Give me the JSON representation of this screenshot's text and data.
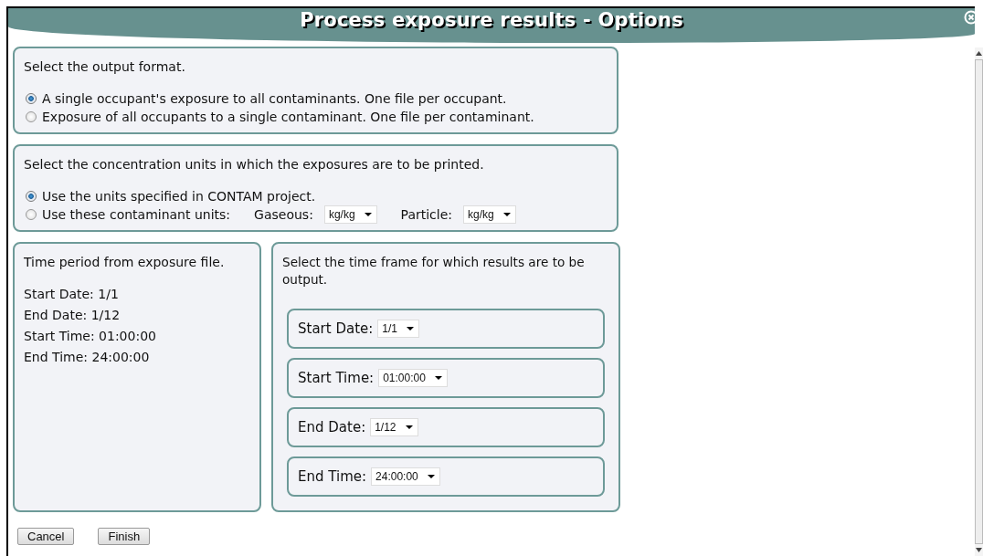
{
  "window": {
    "title": "Process exposure results - Options"
  },
  "output_format": {
    "prompt": "Select the output format.",
    "options": [
      {
        "label": "A single occupant's exposure to all contaminants. One file per occupant.",
        "selected": true
      },
      {
        "label": "Exposure of all occupants to a single contaminant. One file per contaminant.",
        "selected": false
      }
    ]
  },
  "units": {
    "prompt": "Select the concentration units in which the exposures are to be printed.",
    "options": [
      {
        "label": "Use the units specified in CONTAM project.",
        "selected": true
      },
      {
        "label": "Use these contaminant units:",
        "selected": false,
        "selects": [
          {
            "label": "Gaseous:",
            "value": "kg/kg"
          },
          {
            "label": "Particle:",
            "value": "kg/kg"
          }
        ]
      }
    ]
  },
  "time_period": {
    "heading": "Time period from exposure file.",
    "lines": [
      "Start Date: 1/1",
      "End Date: 1/12",
      "Start Time: 01:00:00",
      "End Time: 24:00:00"
    ]
  },
  "time_frame": {
    "prompt": "Select the time frame for which results are to be output.",
    "fields": [
      {
        "label": "Start Date:",
        "value": "1/1"
      },
      {
        "label": "Start Time:",
        "value": "01:00:00"
      },
      {
        "label": "End Date:",
        "value": "1/12"
      },
      {
        "label": "End Time:",
        "value": "24:00:00"
      }
    ]
  },
  "buttons": [
    "Cancel",
    "Finish"
  ]
}
